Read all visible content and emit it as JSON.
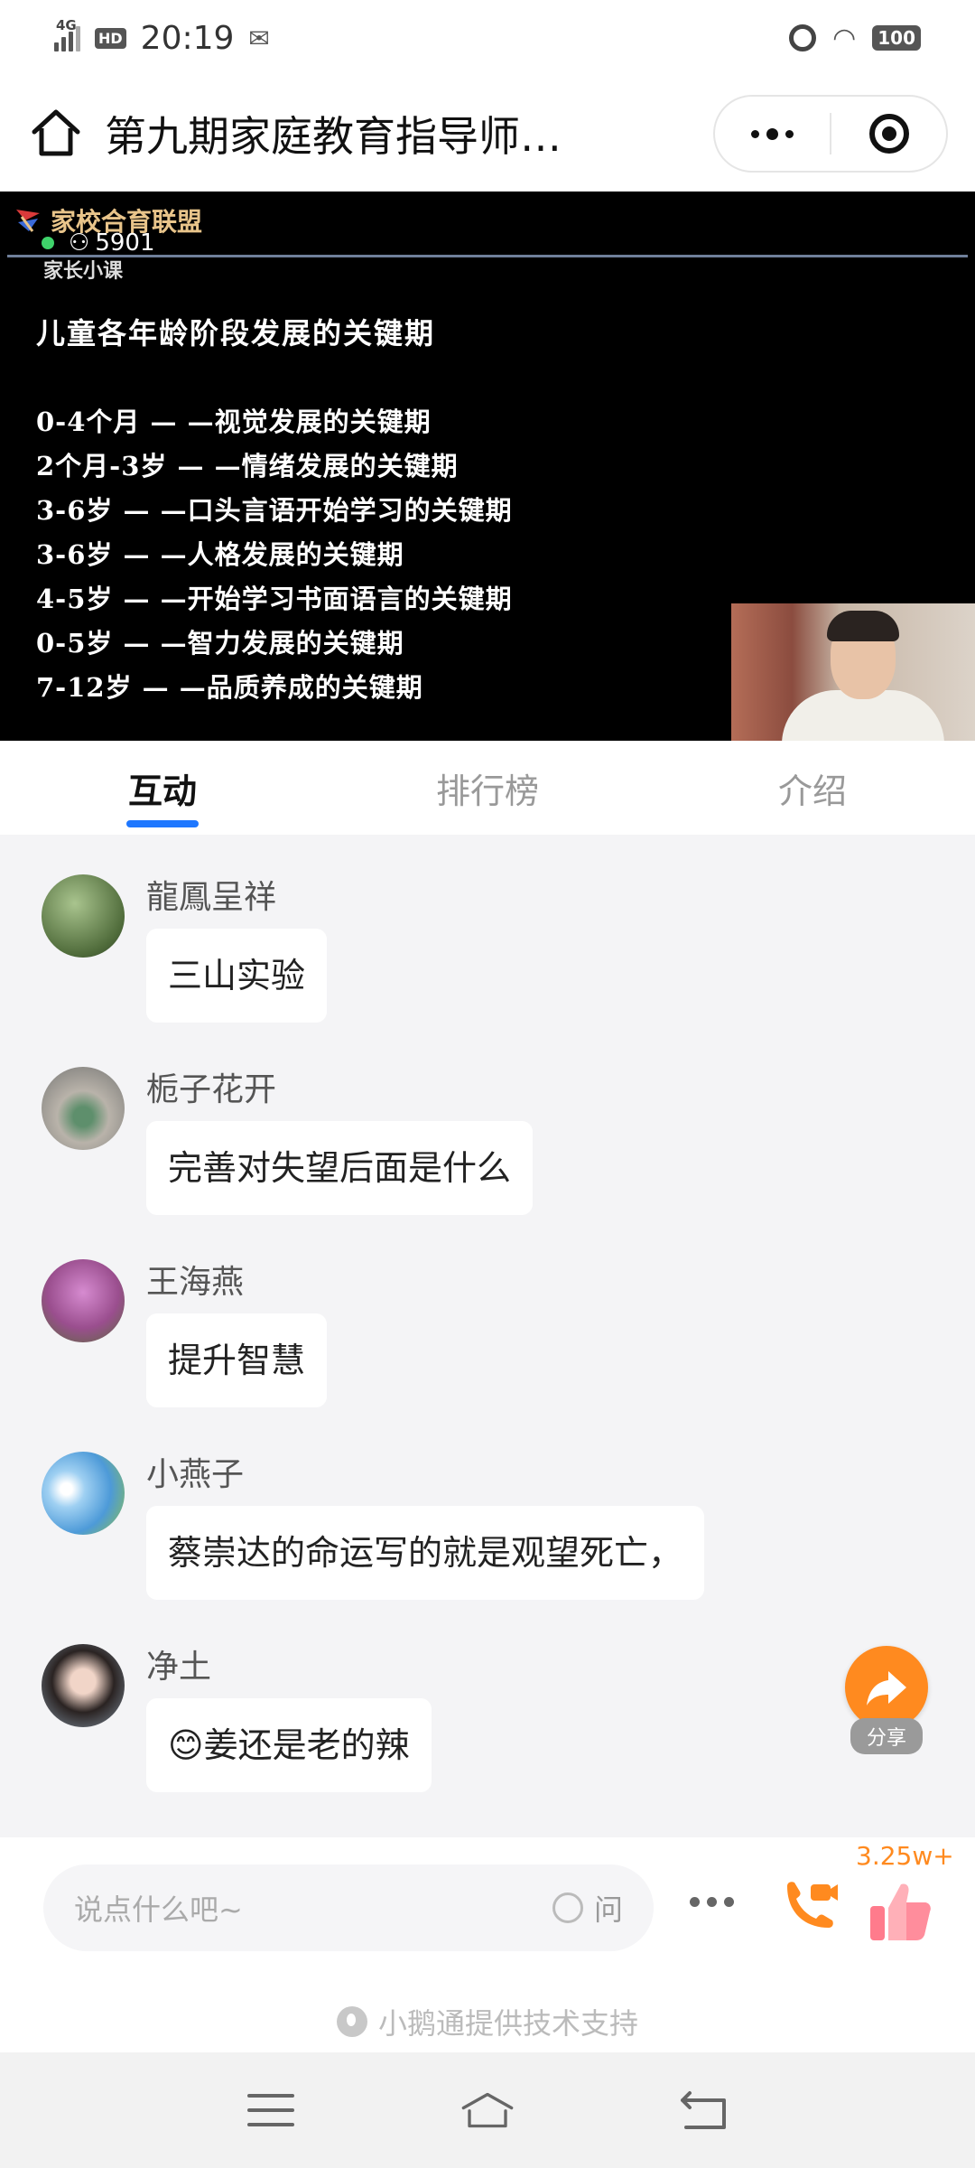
{
  "status_bar": {
    "network": "4G",
    "hd_badge": "HD",
    "time": "20:19",
    "battery": "100",
    "icons": [
      "signal-icon",
      "wechat-icon",
      "alarm-icon",
      "wifi-icon",
      "battery-icon"
    ]
  },
  "header": {
    "title": "第九期家庭教育指导师…",
    "icons": [
      "home-icon",
      "more-dots-icon",
      "close-target-icon"
    ]
  },
  "video": {
    "logo_text": "家校合育联盟",
    "viewer_count": "5901",
    "sub_label": "家长小课",
    "slide_title": "儿童各年龄阶段发展的关键期",
    "slide_lines": [
      "0-4个月 — —视觉发展的关键期",
      "2个月-3岁 — —情绪发展的关键期",
      "3-6岁 — —口头言语开始学习的关键期",
      "3-6岁 — —人格发展的关键期",
      "4-5岁 — —开始学习书面语言的关键期",
      "0-5岁 — —智力发展的关键期",
      "7-12岁 — —品质养成的关键期"
    ]
  },
  "tabs": [
    {
      "label": "互动",
      "active": true
    },
    {
      "label": "排行榜",
      "active": false
    },
    {
      "label": "介绍",
      "active": false
    }
  ],
  "messages": [
    {
      "name": "龍鳳呈祥",
      "text": "三山实验",
      "avatar_color": "#6f8a55"
    },
    {
      "name": "栀子花开",
      "text": "完善对失望后面是什么",
      "avatar_color": "#8a8f8c"
    },
    {
      "name": "王海燕",
      "text": "提升智慧",
      "avatar_color": "#b35aa0"
    },
    {
      "name": "小燕子",
      "text": "蔡崇达的命运写的就是观望死亡，",
      "avatar_color": "#5d9fd8"
    },
    {
      "name": "净土",
      "text": "😊姜还是老的辣",
      "avatar_color": "#3a3a3a"
    }
  ],
  "share": {
    "label": "分享"
  },
  "input_bar": {
    "placeholder": "说点什么吧~",
    "ask_label": "问",
    "like_count": "3.25w+"
  },
  "footer": {
    "powered_by": "小鹅通提供技术支持"
  },
  "colors": {
    "accent": "#1e77ff",
    "orange": "#ff8a1f"
  }
}
